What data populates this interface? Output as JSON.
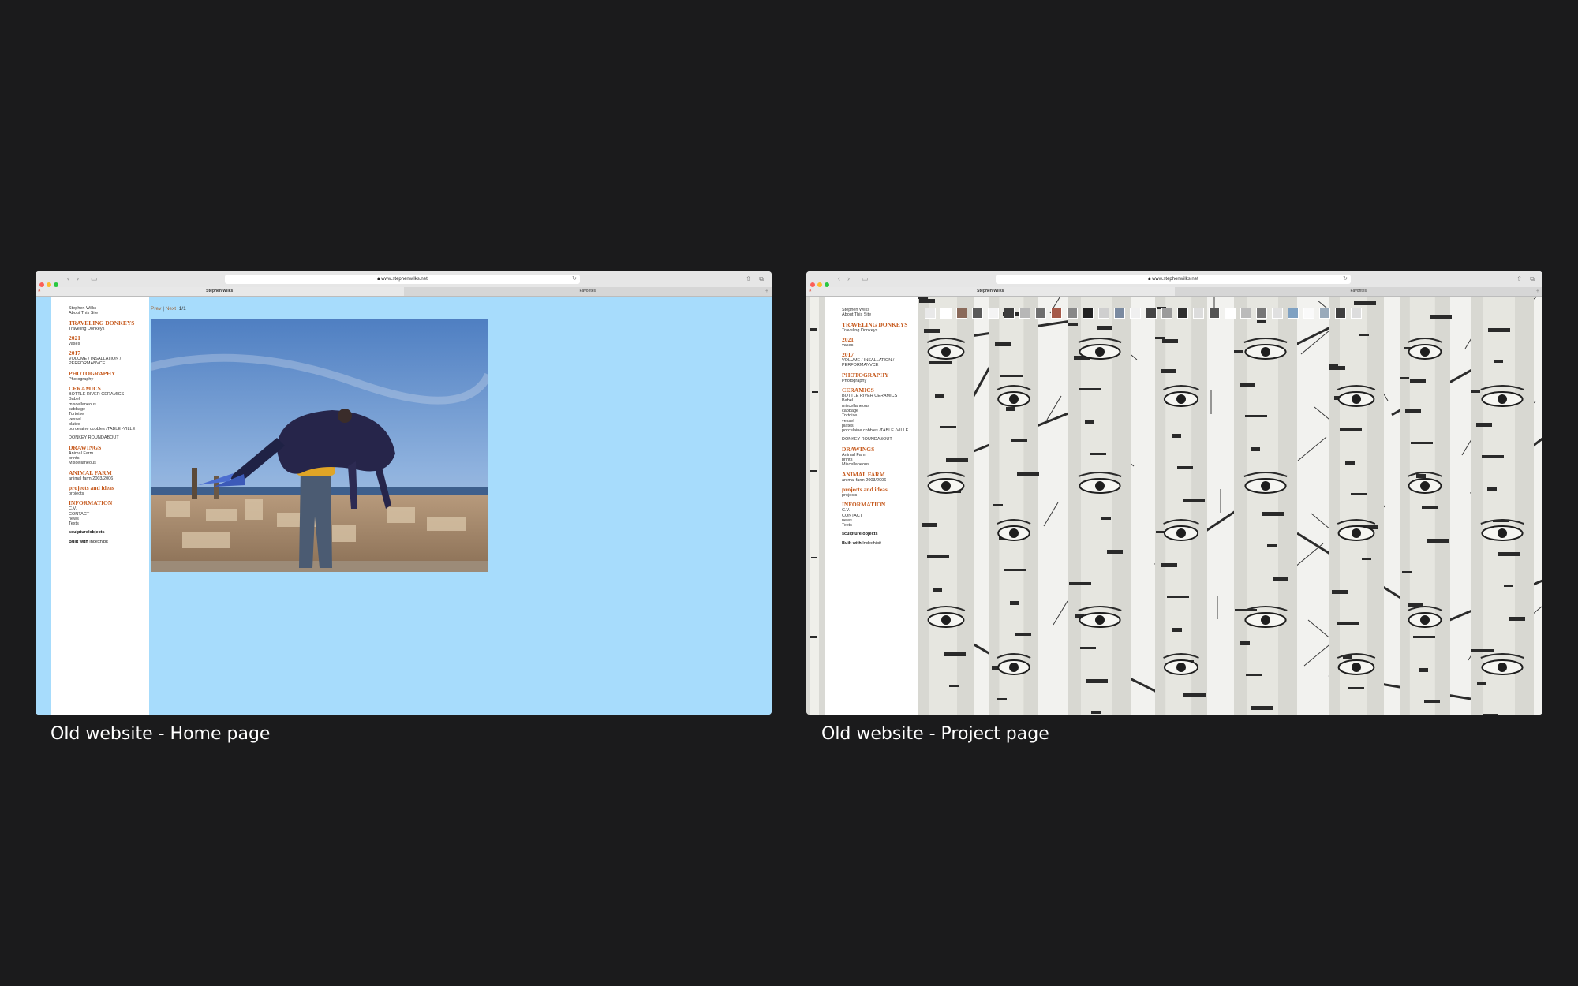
{
  "windows": [
    {
      "url": "www.stephenwilks.net",
      "tabs": [
        "Stephen Wilks",
        "Favorites"
      ],
      "caption": "Old website - Home page",
      "pager": {
        "prev": "Prev",
        "sep": "|",
        "next": "Next",
        "count": "1/1"
      }
    },
    {
      "url": "www.stephenwilks.net",
      "tabs": [
        "Stephen Wilks",
        "Favorites"
      ],
      "caption": "Old website - Project page"
    }
  ],
  "menu": [
    {
      "type": "link",
      "text": "Stephen Wilks"
    },
    {
      "type": "link",
      "text": "About This Site"
    },
    {
      "type": "head",
      "text": "TRAVELING DONKEYS"
    },
    {
      "type": "link",
      "text": "Traveling Donkeys"
    },
    {
      "type": "head",
      "text": "2021"
    },
    {
      "type": "link",
      "text": "vases"
    },
    {
      "type": "head",
      "text": "2017"
    },
    {
      "type": "link",
      "text": "VOLUME / INSALLATION /"
    },
    {
      "type": "link",
      "text": "PERFORMANVCE"
    },
    {
      "type": "head",
      "text": "PHOTOGRAPHY"
    },
    {
      "type": "link",
      "text": "Photography"
    },
    {
      "type": "head",
      "text": "CERAMICS"
    },
    {
      "type": "link",
      "text": "BOTTLE RIVER CERAMICS"
    },
    {
      "type": "link",
      "text": "Babel"
    },
    {
      "type": "link",
      "text": "miscellaneous"
    },
    {
      "type": "link",
      "text": "cabbage"
    },
    {
      "type": "link",
      "text": "Tortoise"
    },
    {
      "type": "link",
      "text": "vessel"
    },
    {
      "type": "link",
      "text": "plates"
    },
    {
      "type": "link",
      "text": "porcelaine cobbles /TABLE -VILLE"
    },
    {
      "type": "gap",
      "text": "DONKEY ROUNDABOUT"
    },
    {
      "type": "head",
      "text": "DRAWINGS"
    },
    {
      "type": "link",
      "text": "Animal Farm"
    },
    {
      "type": "link",
      "text": "prints"
    },
    {
      "type": "link",
      "text": "Miscellaneous"
    },
    {
      "type": "head",
      "text": "ANIMAL FARM"
    },
    {
      "type": "link",
      "text": "animal farm 2003/2006"
    },
    {
      "type": "head",
      "text": "projects and ideas"
    },
    {
      "type": "link",
      "text": "projects"
    },
    {
      "type": "head",
      "text": "INFORMATION"
    },
    {
      "type": "link",
      "text": "C.V."
    },
    {
      "type": "link",
      "text": "CONTACT"
    },
    {
      "type": "link",
      "text": "news"
    },
    {
      "type": "link",
      "text": "Texts"
    },
    {
      "type": "bold",
      "text": "sculpture/objects"
    },
    {
      "type": "built",
      "text": "Built with",
      "extra": "Indexhibit"
    }
  ],
  "colors": {
    "background": "#1b1b1c",
    "home_bg": "#a7dcfc",
    "menu_heading": "#c65a1e"
  },
  "icons": [
    "traffic-lights",
    "back-arrow-icon",
    "forward-arrow-icon",
    "sidebar-icon",
    "lock-icon",
    "reload-icon",
    "share-icon",
    "new-tab-icon"
  ]
}
